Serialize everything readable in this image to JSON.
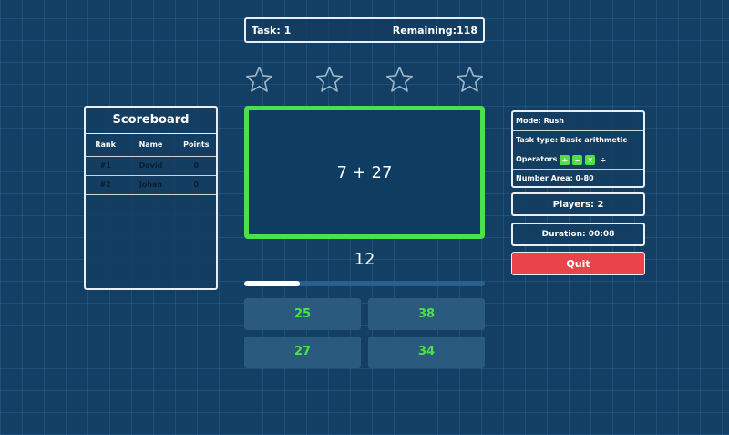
{
  "task_bar": {
    "task_label": "Task: 1",
    "remaining_label": "Remaining:118"
  },
  "stars": {
    "count": 4,
    "filled": 0,
    "icon": "star-outline-icon"
  },
  "question": {
    "text": "7 + 27"
  },
  "timer": {
    "value": "12",
    "progress_fraction": 0.23
  },
  "answers": [
    {
      "label": "25"
    },
    {
      "label": "38"
    },
    {
      "label": "27"
    },
    {
      "label": "34"
    }
  ],
  "scoreboard": {
    "title": "Scoreboard",
    "columns": [
      "Rank",
      "Name",
      "Points"
    ],
    "rows": [
      {
        "rank": "#1",
        "name": "David",
        "points": "0"
      },
      {
        "rank": "#2",
        "name": "Johan",
        "points": "0"
      }
    ]
  },
  "info": {
    "mode": "Mode: Rush",
    "task_type": "Task type: Basic arithmetic",
    "operators_label": "Operators",
    "operators": [
      {
        "symbol": "+",
        "enabled": true
      },
      {
        "symbol": "−",
        "enabled": true
      },
      {
        "symbol": "×",
        "enabled": true
      },
      {
        "symbol": "÷",
        "enabled": false
      }
    ],
    "number_area": "Number Area: 0-80"
  },
  "players": "Players: 2",
  "duration": "Duration: 00:08",
  "quit_label": "Quit",
  "colors": {
    "background": "#123f63",
    "accent_green": "#4ee04a",
    "quit_red": "#e9434c",
    "border": "#e8eef4"
  }
}
